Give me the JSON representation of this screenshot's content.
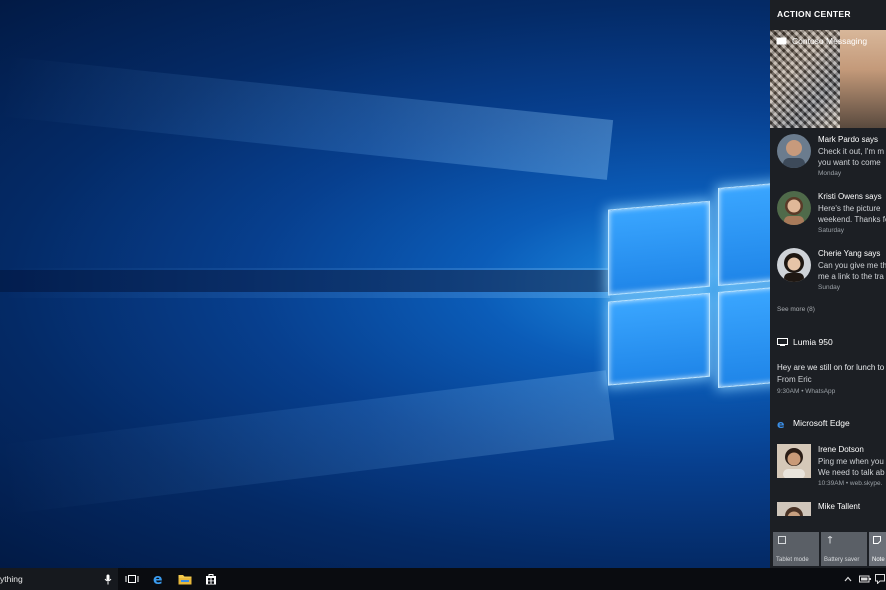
{
  "desktop": {
    "wallpaper": "windows-10-hero",
    "accent": "#1f85e8"
  },
  "action_center": {
    "title": "ACTION CENTER",
    "groups": [
      {
        "app": "Contoso Messaging",
        "icon": "message-icon",
        "messages": [
          {
            "name": "Mark Pardo says",
            "line1": "Check it out, I'm m",
            "line2": "you want to come",
            "time": "Monday",
            "avatar_color": "#b9876a"
          },
          {
            "name": "Kristi Owens says",
            "line1": "Here's the picture",
            "line2": "weekend. Thanks fo",
            "time": "Saturday",
            "avatar_color": "#c79a6e"
          },
          {
            "name": "Cherie Yang says",
            "line1": "Can you give me th",
            "line2": "me a link to the tra",
            "time": "Sunday",
            "avatar_color": "#5a4838"
          }
        ],
        "see_more": "See more (8)"
      },
      {
        "app": "Lumia 950",
        "icon": "phone-icon",
        "text": "Hey are we still on for lunch to",
        "from": "From Eric",
        "meta": "9:30AM  •  WhatsApp"
      },
      {
        "app": "Microsoft Edge",
        "icon": "edge-icon",
        "messages": [
          {
            "name": "Irene Dotson",
            "line1": "Ping me when you",
            "line2": "We need to talk ab",
            "time": "10:39AM  •  web.skype.",
            "avatar_color": "#a87a5e"
          },
          {
            "name": "Mike Tallent",
            "line1": "",
            "line2": "",
            "time": "",
            "avatar_color": "#8a6a55"
          }
        ]
      }
    ],
    "quick_actions": [
      {
        "label": "Tablet mode",
        "icon": "tablet-icon"
      },
      {
        "label": "Battery saver",
        "icon": "battery-saver-icon"
      },
      {
        "label": "Note",
        "icon": "note-icon"
      }
    ]
  },
  "taskbar": {
    "search_placeholder": "ything",
    "icons": [
      "microphone-icon",
      "task-view-icon",
      "edge-icon",
      "file-explorer-icon",
      "store-icon"
    ],
    "tray": [
      "chevron-up-icon",
      "battery-icon"
    ]
  }
}
